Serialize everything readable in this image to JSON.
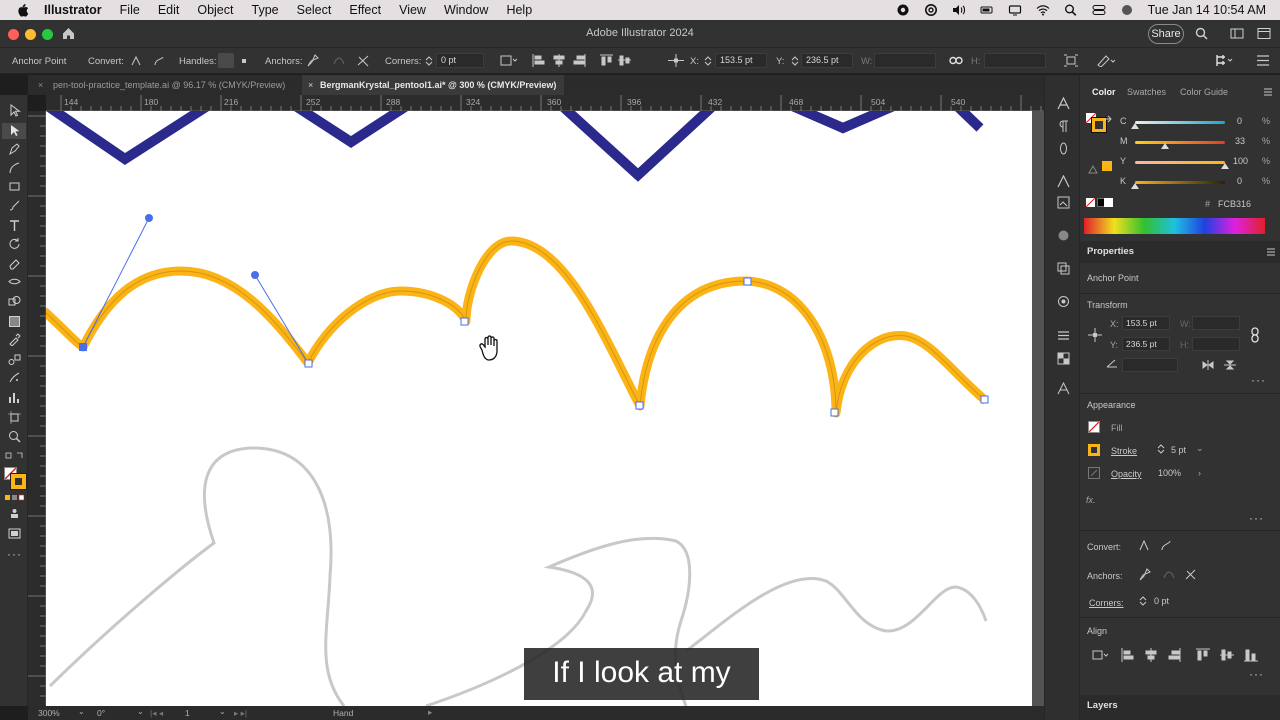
{
  "menubar": {
    "app": "Illustrator",
    "menus": [
      "File",
      "Edit",
      "Object",
      "Type",
      "Select",
      "Effect",
      "View",
      "Window",
      "Help"
    ],
    "clock": "Tue Jan 14  10:54 AM"
  },
  "window": {
    "title": "Adobe Illustrator 2024",
    "share_label": "Share"
  },
  "controlbar": {
    "selection_type": "Anchor Point",
    "convert_label": "Convert:",
    "handles_label": "Handles:",
    "anchors_label": "Anchors:",
    "corners_label": "Corners:",
    "corners_value": "0 pt",
    "x_label": "X:",
    "x_value": "153.5 pt",
    "y_label": "Y:",
    "y_value": "236.5 pt",
    "w_label": "W:",
    "h_label": "H:"
  },
  "doc_tabs": [
    {
      "label": "pen-tool-practice_template.ai @ 96.17 % (CMYK/Preview)",
      "active": false
    },
    {
      "label": "BergmanKrystal_pentool1.ai* @ 300 % (CMYK/Preview)",
      "active": true
    }
  ],
  "ruler": {
    "ticks": [
      "144",
      "180",
      "216",
      "252",
      "288",
      "324",
      "360",
      "396",
      "432",
      "468",
      "504",
      "540"
    ]
  },
  "status": {
    "zoom": "300%",
    "rotation": "0°",
    "artboard": "1",
    "tool": "Hand"
  },
  "subtitle": "If I look at my",
  "color_panel": {
    "tabs": [
      "Color",
      "Swatches",
      "Color Guide"
    ],
    "channels": [
      {
        "name": "C",
        "value": "0",
        "color": "#1aa6c8"
      },
      {
        "name": "M",
        "value": "33",
        "color": "#d43c7a"
      },
      {
        "name": "Y",
        "value": "100",
        "color": "#e6d21a"
      },
      {
        "name": "K",
        "value": "0",
        "color": "#9a9a9a"
      }
    ],
    "hex": "FCB316"
  },
  "properties": {
    "title": "Properties",
    "selection": "Anchor Point",
    "transform_label": "Transform",
    "x_label": "X:",
    "x_value": "153.5 pt",
    "y_label": "Y:",
    "y_value": "236.5 pt",
    "w_label": "W:",
    "h_label": "H:",
    "appearance_label": "Appearance",
    "fill_label": "Fill",
    "stroke_label": "Stroke",
    "stroke_value": "5 pt",
    "opacity_label": "Opacity",
    "opacity_value": "100%",
    "fx_label": "fx.",
    "convert_label": "Convert:",
    "anchors_label": "Anchors:",
    "corners_label": "Corners:",
    "corners_value": "0 pt",
    "align_label": "Align",
    "layers_label": "Layers"
  },
  "colors": {
    "stroke_orange": "#fcb316",
    "navy": "#2b2a8c",
    "handle_blue": "#4a6fe8",
    "trace_gray": "#c8c8c8"
  }
}
